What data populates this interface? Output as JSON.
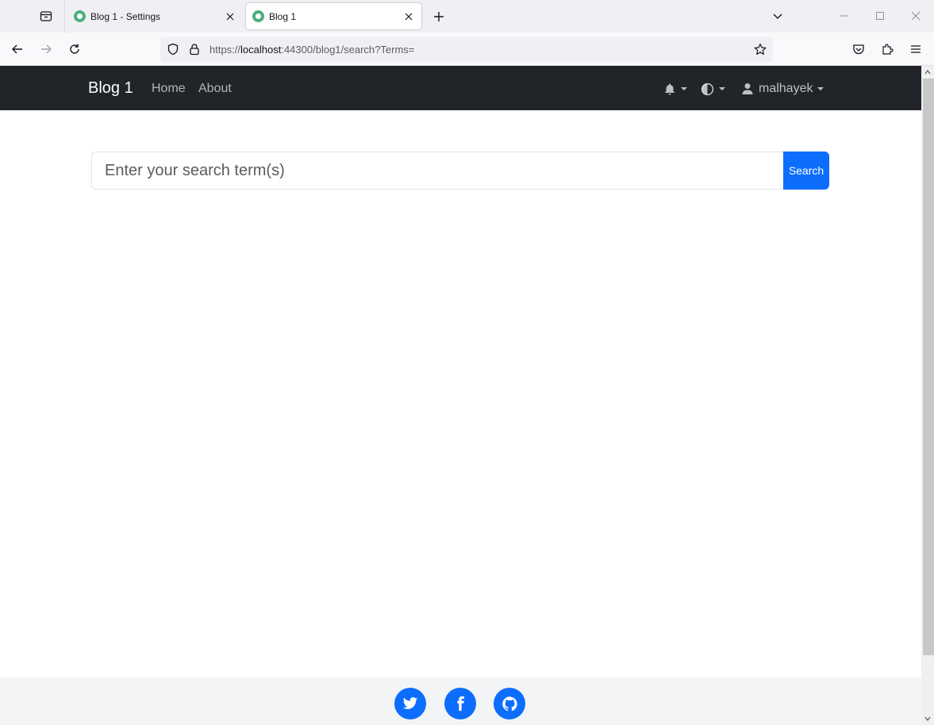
{
  "browser": {
    "tabs": [
      {
        "title": "Blog 1 - Settings",
        "active": false
      },
      {
        "title": "Blog 1",
        "active": true
      }
    ],
    "url": {
      "scheme": "https://",
      "host": "localhost",
      "rest": ":44300/blog1/search?Terms="
    }
  },
  "site": {
    "brand": "Blog 1",
    "nav_links": [
      "Home",
      "About"
    ],
    "user_name": "malhayek"
  },
  "search": {
    "placeholder": "Enter your search term(s)",
    "button_label": "Search"
  },
  "footer": {
    "social_icons": [
      "twitter-icon",
      "facebook-icon",
      "github-icon"
    ]
  },
  "colors": {
    "navbar_bg": "#212529",
    "primary": "#0d6efd",
    "footer_bg": "#f3f4f5"
  }
}
